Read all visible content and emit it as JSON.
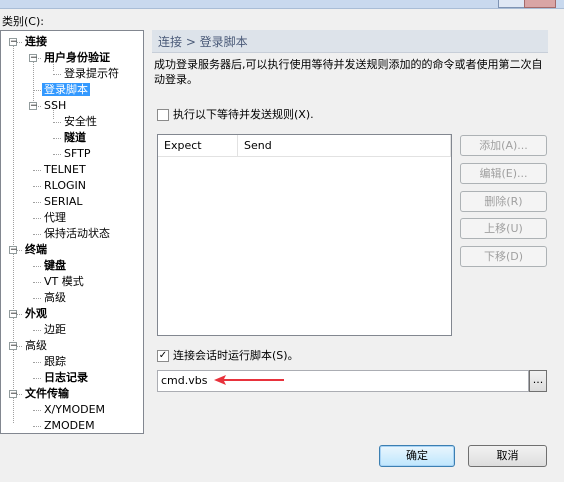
{
  "category_label": "类别(C):",
  "tree": {
    "items": [
      {
        "label": "连接",
        "bold": true,
        "expander": "−"
      },
      {
        "label": "用户身份验证",
        "bold": true,
        "expander": "−"
      },
      {
        "label": "登录提示符"
      },
      {
        "label": "登录脚本",
        "selected": true
      },
      {
        "label": "SSH",
        "expander": "−"
      },
      {
        "label": "安全性"
      },
      {
        "label": "隧道",
        "bold": true
      },
      {
        "label": "SFTP"
      },
      {
        "label": "TELNET"
      },
      {
        "label": "RLOGIN"
      },
      {
        "label": "SERIAL"
      },
      {
        "label": "代理"
      },
      {
        "label": "保持活动状态"
      },
      {
        "label": "终端",
        "bold": true,
        "expander": "−"
      },
      {
        "label": "键盘",
        "bold": true
      },
      {
        "label": "VT 模式"
      },
      {
        "label": "高级"
      },
      {
        "label": "外观",
        "bold": true,
        "expander": "−"
      },
      {
        "label": "边距"
      },
      {
        "label": "高级",
        "expander": "−"
      },
      {
        "label": "跟踪"
      },
      {
        "label": "日志记录",
        "bold": true
      },
      {
        "label": "文件传输",
        "bold": true,
        "expander": "−"
      },
      {
        "label": "X/YMODEM"
      },
      {
        "label": "ZMODEM"
      }
    ]
  },
  "header": {
    "breadcrumb": "连接 > 登录脚本"
  },
  "description": "成功登录服务器后,可以执行使用等待并发送规则添加的的命令或者使用第二次自动登录。",
  "wait_send_checkbox": {
    "label": "执行以下等待并发送规则(X).",
    "checked": false
  },
  "rules_table": {
    "columns": [
      "Expect",
      "Send"
    ],
    "rows": []
  },
  "side_buttons": {
    "add": "添加(A)...",
    "edit": "编辑(E)...",
    "delete": "删除(R)",
    "up": "上移(U)",
    "down": "下移(D)"
  },
  "run_script_checkbox": {
    "label": "连接会话时运行脚本(S)。",
    "checked": true,
    "mark": "✓"
  },
  "script_path": "cmd.vbs",
  "browse_label": "...",
  "ok_label": "确定",
  "cancel_label": "取消",
  "annotation_color": "#e8323c"
}
